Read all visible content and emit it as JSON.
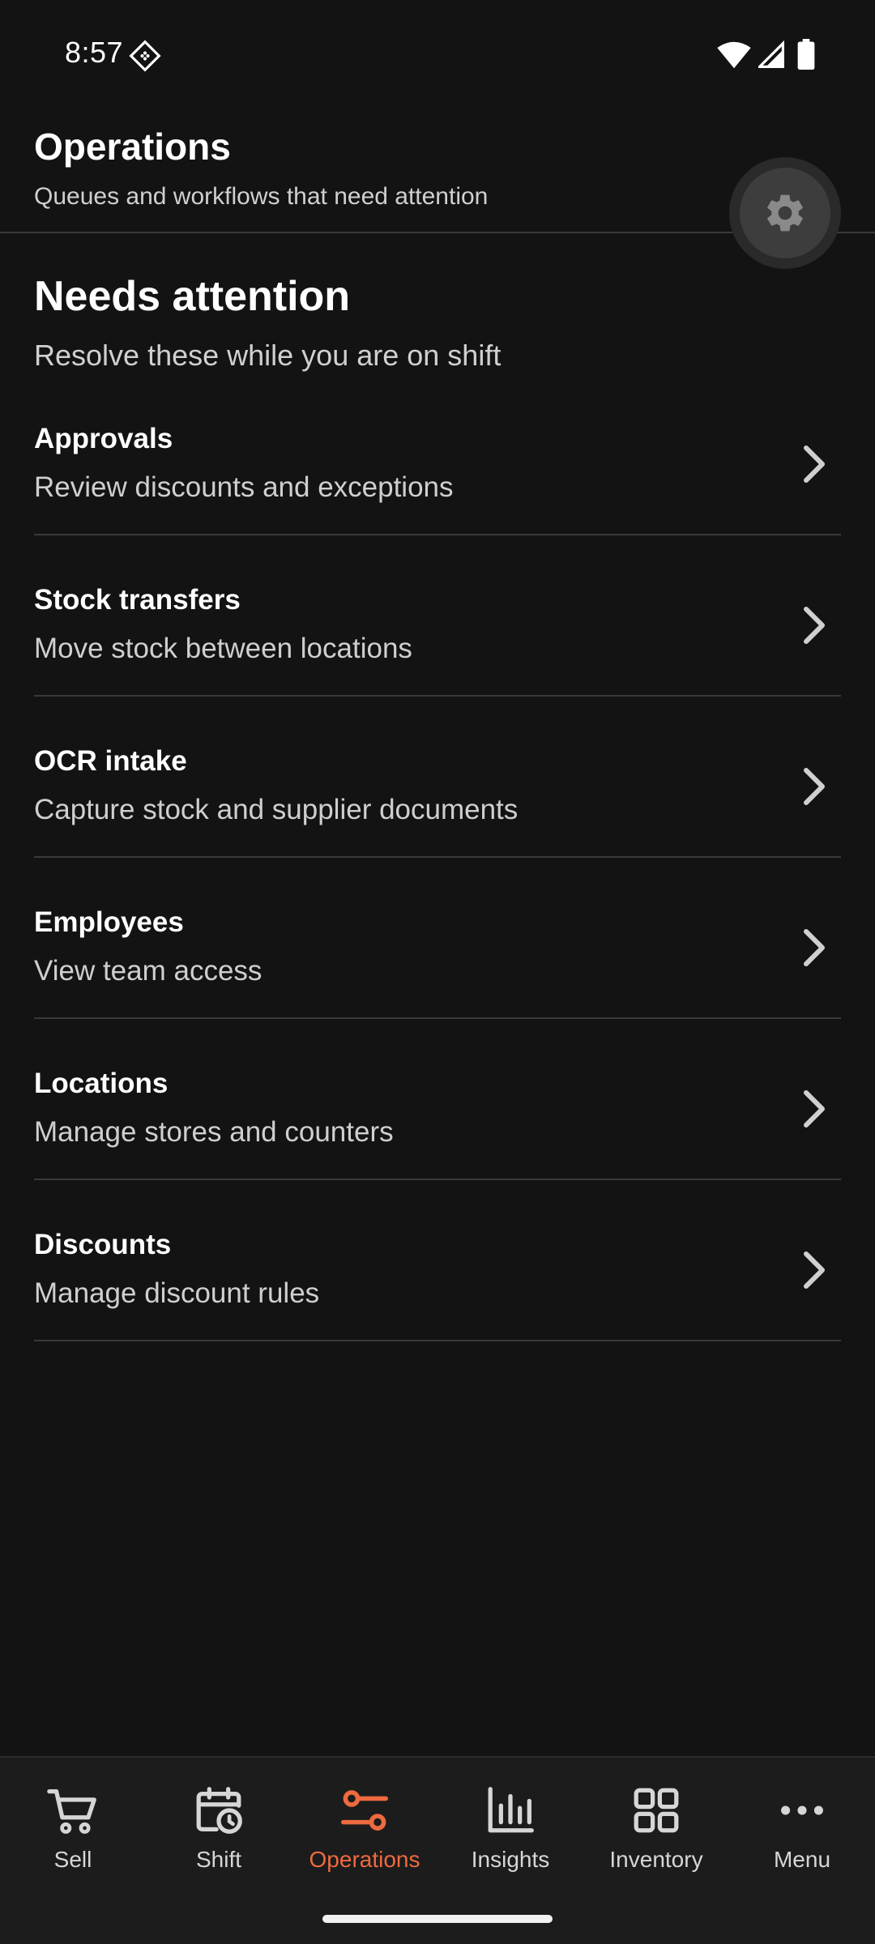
{
  "status_bar": {
    "time": "8:57",
    "icons": [
      "vpn-key-icon",
      "wifi-icon",
      "signal-icon",
      "battery-icon"
    ]
  },
  "header": {
    "title": "Operations",
    "subtitle": "Queues and workflows that need attention",
    "settings_icon": "gear-icon"
  },
  "section": {
    "title": "Needs attention",
    "subtitle": "Resolve these while you are on shift"
  },
  "items": [
    {
      "title": "Approvals",
      "description": "Review discounts and exceptions"
    },
    {
      "title": "Stock transfers",
      "description": "Move stock between locations"
    },
    {
      "title": "OCR intake",
      "description": "Capture stock and supplier documents"
    },
    {
      "title": "Employees",
      "description": "View team access"
    },
    {
      "title": "Locations",
      "description": "Manage stores and counters"
    },
    {
      "title": "Discounts",
      "description": "Manage discount rules"
    }
  ],
  "bottom_nav": {
    "active": "Operations",
    "items": [
      {
        "label": "Sell",
        "icon": "cart-icon"
      },
      {
        "label": "Shift",
        "icon": "calendar-clock-icon"
      },
      {
        "label": "Operations",
        "icon": "sliders-icon"
      },
      {
        "label": "Insights",
        "icon": "bar-chart-icon"
      },
      {
        "label": "Inventory",
        "icon": "grid-icon"
      },
      {
        "label": "Menu",
        "icon": "more-dots-icon"
      }
    ]
  },
  "colors": {
    "background": "#131313",
    "accent": "#ee6a3f",
    "divider": "#3a3a3a",
    "nav_background": "#1c1c1c"
  }
}
